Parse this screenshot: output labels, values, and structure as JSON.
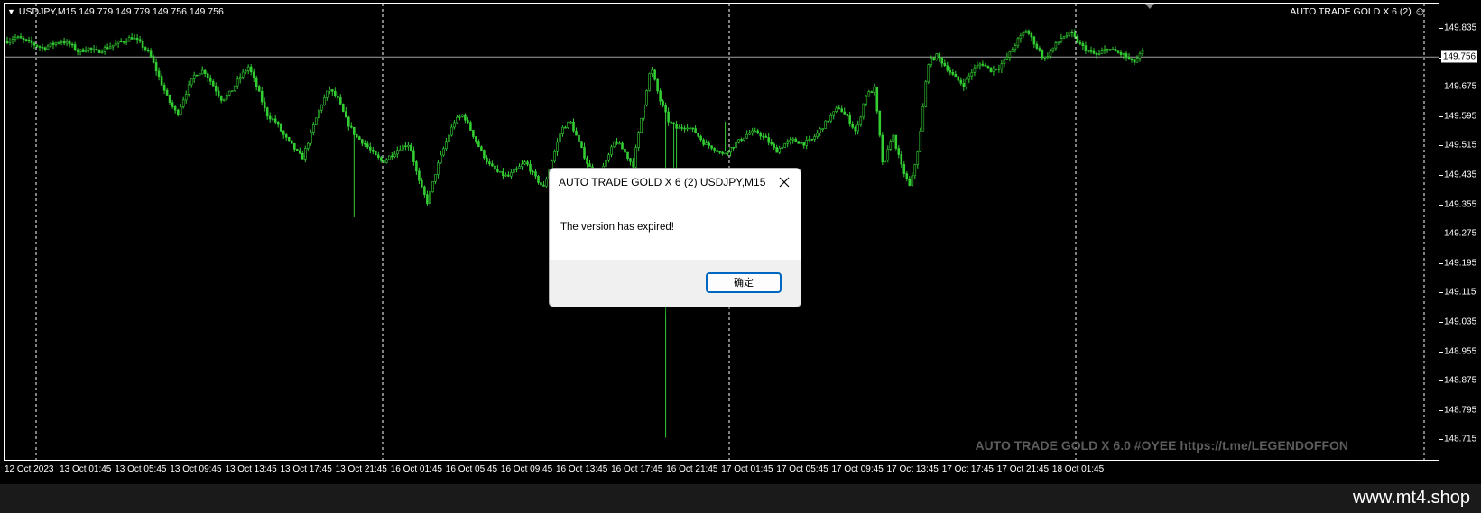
{
  "chart": {
    "symbol_header": "USDJPY,M15  149.779 149.779 149.756 149.756",
    "ea_label": "AUTO TRADE GOLD X 6 (2)",
    "bid_price": "149.756",
    "watermark": "AUTO TRADE GOLD X 6.0 #OYEE https://t.me/LEGENDOFFON",
    "price_axis": [
      "149.835",
      "149.756",
      "149.675",
      "149.595",
      "149.515",
      "149.435",
      "149.355",
      "149.275",
      "149.195",
      "149.115",
      "149.035",
      "148.955",
      "148.875",
      "148.795",
      "148.715"
    ],
    "time_axis": [
      "12 Oct 2023",
      "13 Oct 01:45",
      "13 Oct 05:45",
      "13 Oct 09:45",
      "13 Oct 13:45",
      "13 Oct 17:45",
      "13 Oct 21:45",
      "16 Oct 01:45",
      "16 Oct 05:45",
      "16 Oct 09:45",
      "16 Oct 13:45",
      "16 Oct 17:45",
      "16 Oct 21:45",
      "17 Oct 01:45",
      "17 Oct 05:45",
      "17 Oct 09:45",
      "17 Oct 13:45",
      "17 Oct 17:45",
      "17 Oct 21:45",
      "18 Oct 01:45"
    ],
    "candle_color": "#32cd32",
    "background_color": "#000000",
    "price_path": [
      149.8,
      149.81,
      149.8,
      149.79,
      149.78,
      149.79,
      149.8,
      149.79,
      149.77,
      149.78,
      149.77,
      149.78,
      149.79,
      149.8,
      149.81,
      149.79,
      149.76,
      149.7,
      149.64,
      149.6,
      149.66,
      149.71,
      149.72,
      149.68,
      149.64,
      149.66,
      149.7,
      149.73,
      149.67,
      149.6,
      149.58,
      149.54,
      149.51,
      149.48,
      149.55,
      149.62,
      149.67,
      149.64,
      149.58,
      149.54,
      149.52,
      149.49,
      149.47,
      149.49,
      149.51,
      149.52,
      149.42,
      149.36,
      149.45,
      149.52,
      149.58,
      149.6,
      149.55,
      149.5,
      149.46,
      149.44,
      149.43,
      149.45,
      149.47,
      149.43,
      149.4,
      149.48,
      149.56,
      149.58,
      149.52,
      149.46,
      149.43,
      149.47,
      149.53,
      149.5,
      149.46,
      149.6,
      149.73,
      149.64,
      149.58,
      149.56,
      149.57,
      149.55,
      149.52,
      149.51,
      149.49,
      149.51,
      149.53,
      149.55,
      149.55,
      149.53,
      149.5,
      149.52,
      149.53,
      149.52,
      149.53,
      149.56,
      149.59,
      149.62,
      149.59,
      149.55,
      149.65,
      149.67,
      149.45,
      149.55,
      149.46,
      149.4,
      149.52,
      149.74,
      149.76,
      149.73,
      149.7,
      149.68,
      149.72,
      149.74,
      149.72,
      149.73,
      149.76,
      149.8,
      149.83,
      149.79,
      149.75,
      149.78,
      149.81,
      149.82,
      149.79,
      149.77,
      149.76,
      149.78,
      149.77,
      149.76,
      149.74,
      149.77
    ]
  },
  "dialog": {
    "title": "AUTO TRADE GOLD X 6 (2) USDJPY,M15",
    "message": "The version has expired!",
    "ok_label": "确定"
  },
  "footer": {
    "site": "www.mt4.shop"
  }
}
